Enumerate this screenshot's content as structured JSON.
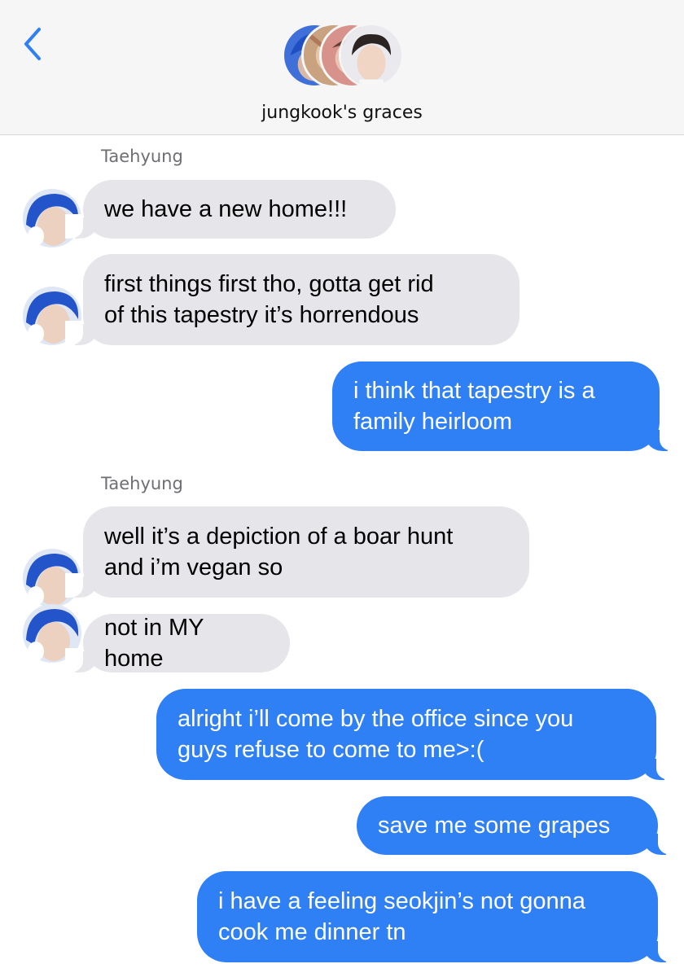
{
  "header": {
    "group_name": "jungkook's graces",
    "back_icon": "chevron-left-icon"
  },
  "colors": {
    "incoming_bubble": "#e5e5ea",
    "outgoing_bubble": "#2f7ff5",
    "header_bg": "#f6f6f6",
    "back_accent": "#2f7ff5"
  },
  "thread": [
    {
      "kind": "sender",
      "text": "Taehyung"
    },
    {
      "kind": "incoming",
      "lines": [
        "we have a new home!!!"
      ]
    },
    {
      "kind": "incoming",
      "lines": [
        "first things first tho, gotta get rid",
        "of this tapestry it’s horrendous"
      ]
    },
    {
      "kind": "outgoing",
      "lines": [
        "i think that tapestry is a",
        "family heirloom"
      ]
    },
    {
      "kind": "sender",
      "text": "Taehyung"
    },
    {
      "kind": "incoming",
      "lines": [
        "well it’s a depiction of a boar hunt",
        "and i’m vegan so"
      ]
    },
    {
      "kind": "incoming",
      "lines": [
        "not in MY home"
      ]
    },
    {
      "kind": "outgoing",
      "lines": [
        "alright i’ll come by the office since you",
        "guys refuse to come to me>:("
      ]
    },
    {
      "kind": "outgoing",
      "lines": [
        "save me some grapes"
      ]
    },
    {
      "kind": "outgoing",
      "lines": [
        "i have a feeling seokjin’s not gonna",
        "cook me dinner tn"
      ]
    }
  ]
}
